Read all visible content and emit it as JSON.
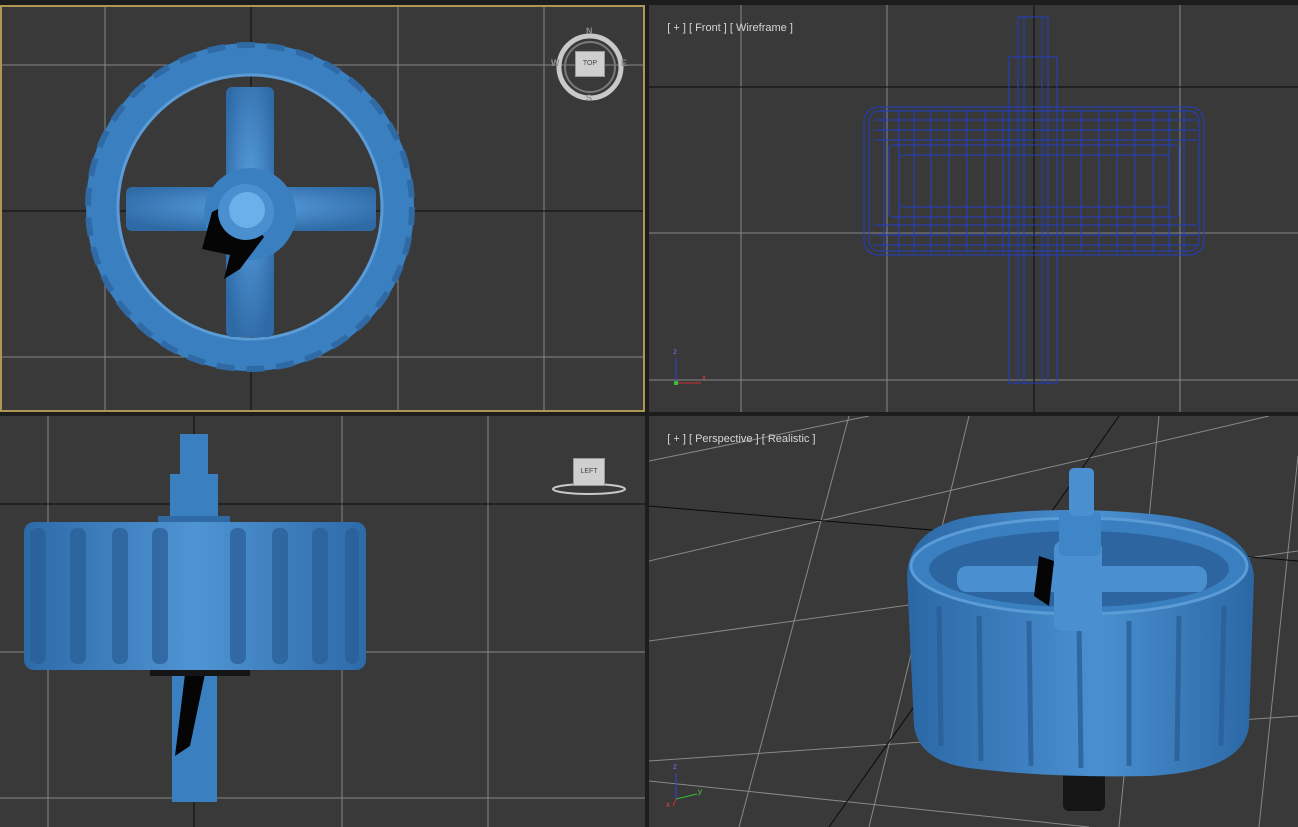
{
  "viewports": {
    "top": {
      "viewcube": {
        "face": "TOP",
        "north": "N",
        "south": "S",
        "east": "E",
        "west": "W"
      }
    },
    "front": {
      "label": {
        "plus": "[ + ]",
        "view": "[ Front ]",
        "shading": "[ Wireframe ]"
      },
      "axis": {
        "z": "z",
        "x": "x"
      }
    },
    "left": {
      "viewcube": {
        "face": "LEFT"
      }
    },
    "perspective": {
      "label": {
        "plus": "[ + ]",
        "view": "[ Perspective ]",
        "shading": "[ Realistic ]"
      },
      "axis": {
        "z": "z",
        "x": "x",
        "y": "y"
      }
    }
  },
  "colors": {
    "viewport_bg": "#393939",
    "grid": "#878787",
    "grid_axis": "#0a0a0a",
    "object_blue": "#3a7fc0",
    "active_border": "#b09655",
    "wire_blue": "#1f3fc4"
  }
}
